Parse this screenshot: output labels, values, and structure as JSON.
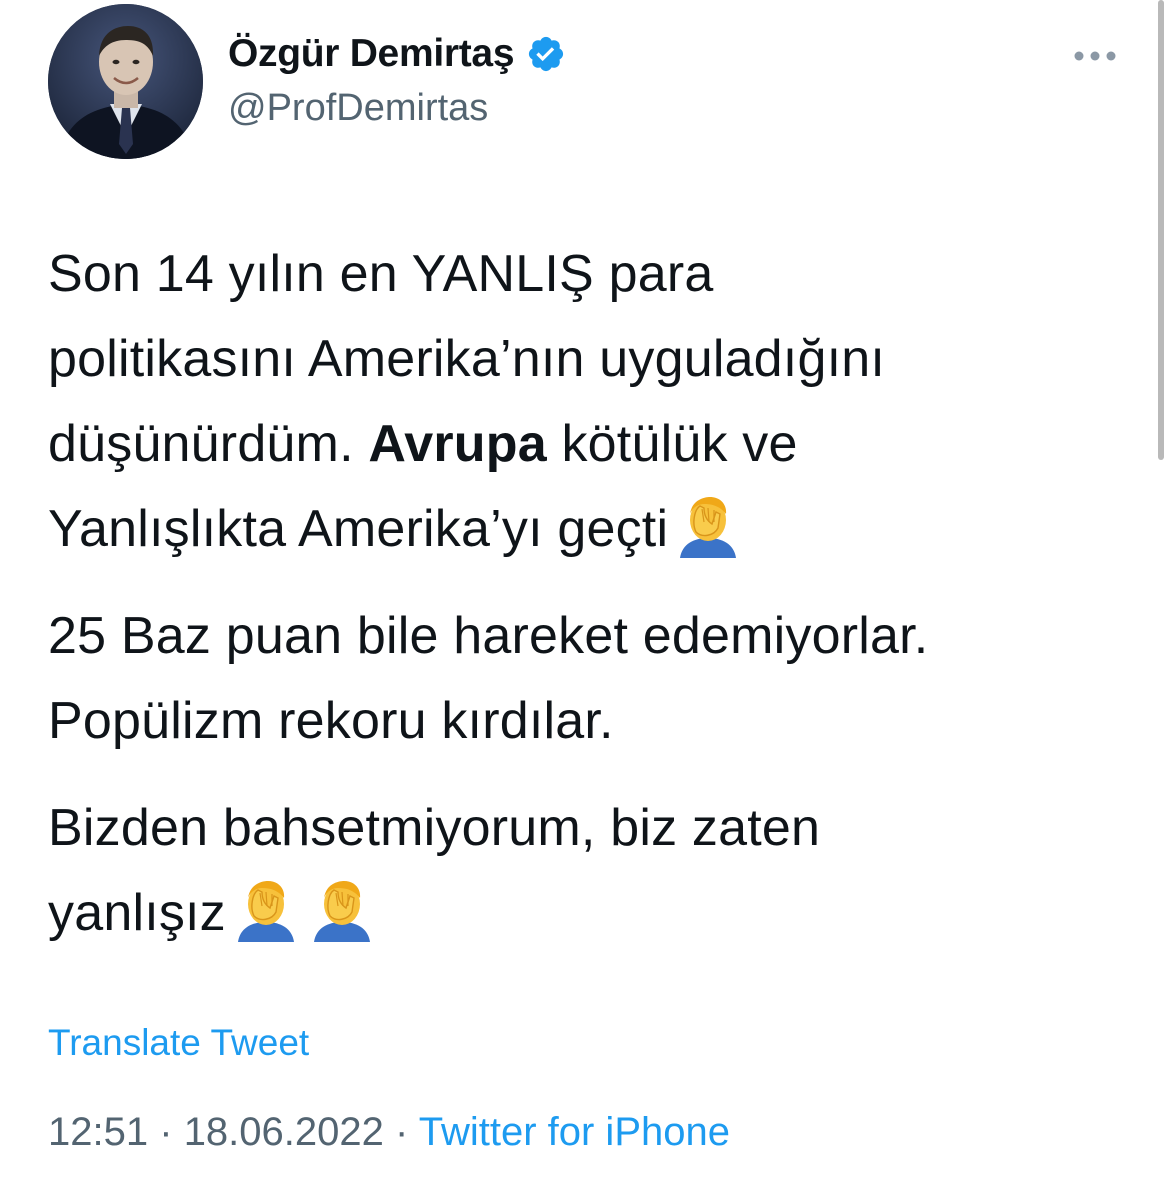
{
  "author": {
    "display_name": "Özgür Demirtaş",
    "handle": "@ProfDemirtas",
    "verified": true,
    "avatar_icon": "profile-photo"
  },
  "tweet": {
    "p1": {
      "line1": "Son 14 yılın en YANLIŞ para",
      "line2": "politikasını Amerika’nın uyguladığını",
      "line3_start": "düşünürdüm.",
      "line3_bold": "Avrupa",
      "line3_end": "kötülük ve",
      "line4": "Yanlışlıkta Amerika’yı geçti"
    },
    "p2": {
      "line1": "25 Baz puan bile hareket edemiyorlar.",
      "line2": "Popülizm rekoru kırdılar."
    },
    "p3": {
      "line1": "Bizden bahsetmiyorum, biz zaten",
      "line2": "yanlışız"
    },
    "emoji": "facepalm-emoji"
  },
  "translate_label": "Translate Tweet",
  "meta": {
    "time": "12:51",
    "separator": "·",
    "date": "18.06.2022",
    "source": "Twitter for iPhone"
  },
  "colors": {
    "link": "#1d9bf0",
    "secondary_text": "#536471",
    "primary_text": "#0f1419"
  }
}
